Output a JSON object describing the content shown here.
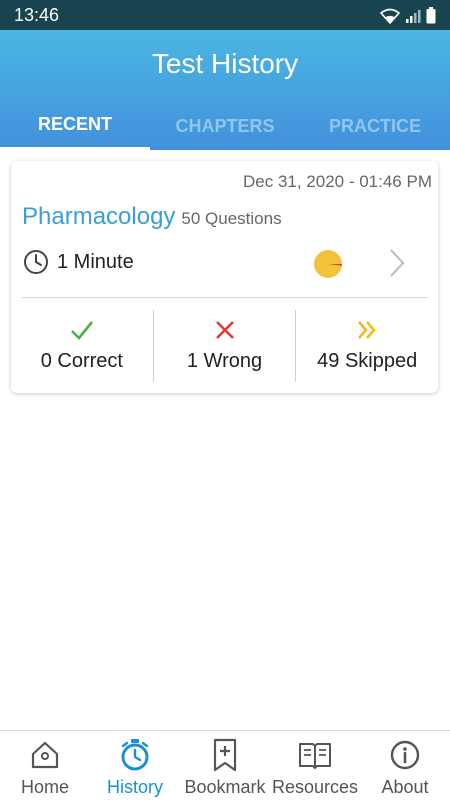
{
  "status_bar": {
    "time": "13:46"
  },
  "header": {
    "title": "Test History"
  },
  "tabs": [
    {
      "label": "RECENT",
      "active": true
    },
    {
      "label": "CHAPTERS",
      "active": false
    },
    {
      "label": "PRACTICE",
      "active": false
    }
  ],
  "test": {
    "date": "Dec 31, 2020 - 01:46 PM",
    "subject": "Pharmacology",
    "questions": "50 Questions",
    "duration": "1 Minute",
    "correct": "0 Correct",
    "wrong": "1 Wrong",
    "skipped": "49 Skipped"
  },
  "nav": [
    {
      "label": "Home",
      "icon": "home-icon"
    },
    {
      "label": "History",
      "icon": "stopwatch-icon",
      "active": true
    },
    {
      "label": "Bookmark",
      "icon": "bookmark-icon"
    },
    {
      "label": "Resources",
      "icon": "book-icon"
    },
    {
      "label": "About",
      "icon": "info-icon"
    }
  ],
  "colors": {
    "header_top": "#4ab7e2",
    "header_bottom": "#4390dc",
    "accent": "#1a8fd1",
    "subject": "#3a9fd4",
    "correct": "#4caf50",
    "wrong": "#e53935",
    "skipped": "#f5b820",
    "pie": "#f5c33b",
    "pie_wrong": "#e53935"
  }
}
